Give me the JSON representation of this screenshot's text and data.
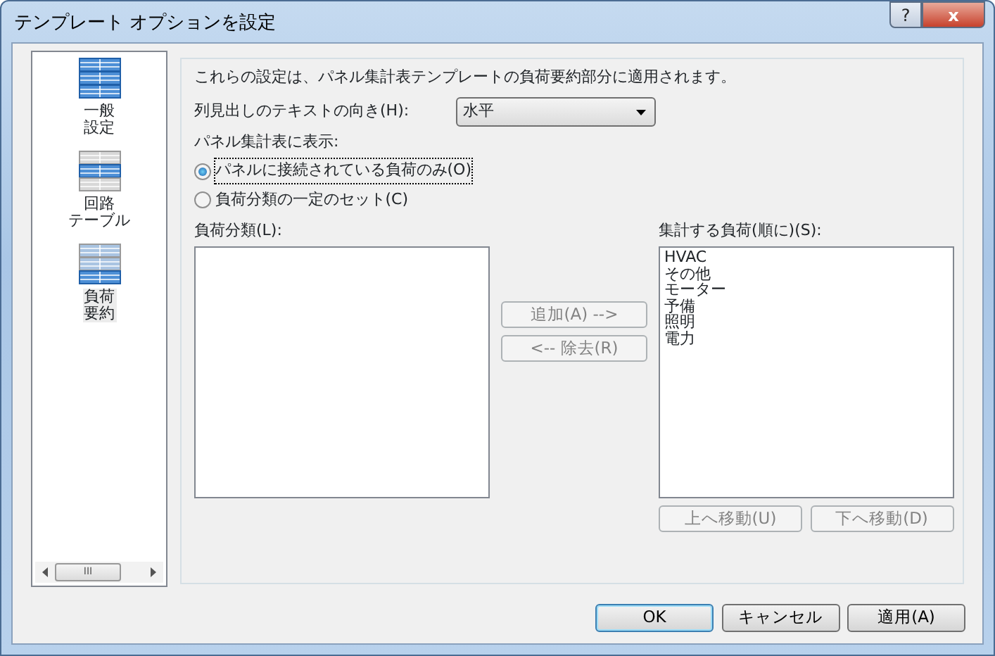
{
  "window": {
    "title": "テンプレート オプションを設定",
    "help_button": "?",
    "close_button": "x"
  },
  "sidebar": {
    "items": [
      {
        "lines": [
          "一般",
          "設定"
        ],
        "selected": false
      },
      {
        "lines": [
          "回路",
          "テーブル"
        ],
        "selected": false
      },
      {
        "lines": [
          "負荷",
          "要約"
        ],
        "selected": true
      }
    ],
    "scrollbar": {
      "thumb": "III"
    }
  },
  "description": "これらの設定は、パネル集計表テンプレートの負荷要約部分に適用されます。",
  "orientation": {
    "label": "列見出しのテキストの向き(H):",
    "value": "水平"
  },
  "display": {
    "label": "パネル集計表に表示:",
    "options": [
      {
        "label": "パネルに接続されている負荷のみ(O)",
        "selected": true,
        "focused": true
      },
      {
        "label": "負荷分類の一定のセット(C)",
        "selected": false,
        "focused": false
      }
    ]
  },
  "load_classes": {
    "label": "負荷分類(L):"
  },
  "transfer_buttons": [
    {
      "label": "追加(A) -->",
      "disabled": true
    },
    {
      "label": "<-- 除去(R)",
      "disabled": true
    }
  ],
  "summary_loads": {
    "label": "集計する負荷(順に)(S):",
    "items": [
      "HVAC",
      "その他",
      "モーター",
      "予備",
      "照明",
      "電力"
    ]
  },
  "order_buttons": [
    {
      "label": "上へ移動(U)",
      "disabled": true
    },
    {
      "label": "下へ移動(D)",
      "disabled": true
    }
  ],
  "buttons": [
    {
      "label": "OK",
      "default": true
    },
    {
      "label": "キャンセル",
      "default": false
    },
    {
      "label": "適用(A)",
      "default": false
    }
  ]
}
